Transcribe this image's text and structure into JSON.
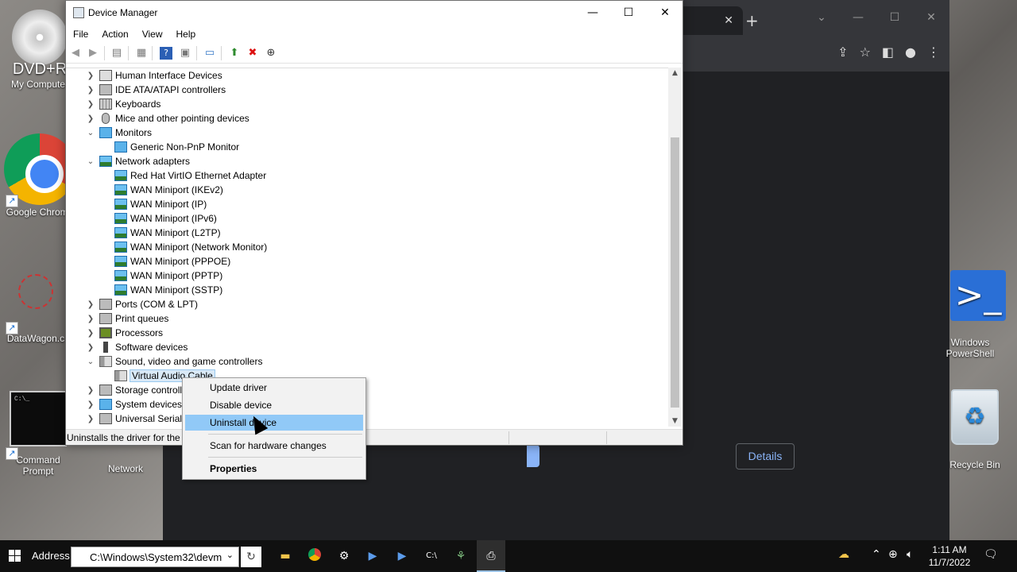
{
  "desktop": {
    "icons": [
      {
        "name": "dvd-drive",
        "label": "DVD+R",
        "sublabel": "My Computer"
      },
      {
        "name": "google-chrome",
        "label": "Google Chrome"
      },
      {
        "name": "datawagon",
        "label": "DataWagon.c"
      },
      {
        "name": "command-prompt",
        "label": "Command Prompt"
      },
      {
        "name": "network",
        "label": "Network"
      },
      {
        "name": "windows-powershell",
        "label": "Windows PowerShell"
      },
      {
        "name": "recycle-bin",
        "label": "Recycle Bin"
      }
    ]
  },
  "browser": {
    "tab_close": "✕",
    "new_tab": "+",
    "details_button": "Details"
  },
  "window": {
    "title": "Device Manager",
    "controls": {
      "minimize": "—",
      "maximize": "☐",
      "close": "✕"
    },
    "menu": [
      "File",
      "Action",
      "View",
      "Help"
    ],
    "tree": [
      {
        "label": "Human Interface Devices",
        "level": 0,
        "state": "collapsed",
        "icon": "hid-icon"
      },
      {
        "label": "IDE ATA/ATAPI controllers",
        "level": 0,
        "state": "collapsed",
        "icon": "ide-controller-icon"
      },
      {
        "label": "Keyboards",
        "level": 0,
        "state": "collapsed",
        "icon": "keyboard-icon"
      },
      {
        "label": "Mice and other pointing devices",
        "level": 0,
        "state": "collapsed",
        "icon": "mouse-icon"
      },
      {
        "label": "Monitors",
        "level": 0,
        "state": "expanded",
        "icon": "monitor-icon"
      },
      {
        "label": "Generic Non-PnP Monitor",
        "level": 1,
        "state": "leaf",
        "icon": "monitor-icon"
      },
      {
        "label": "Network adapters",
        "level": 0,
        "state": "expanded",
        "icon": "network-adapter-icon"
      },
      {
        "label": "Red Hat VirtIO Ethernet Adapter",
        "level": 1,
        "state": "leaf",
        "icon": "network-adapter-icon"
      },
      {
        "label": "WAN Miniport (IKEv2)",
        "level": 1,
        "state": "leaf",
        "icon": "network-adapter-icon"
      },
      {
        "label": "WAN Miniport (IP)",
        "level": 1,
        "state": "leaf",
        "icon": "network-adapter-icon"
      },
      {
        "label": "WAN Miniport (IPv6)",
        "level": 1,
        "state": "leaf",
        "icon": "network-adapter-icon"
      },
      {
        "label": "WAN Miniport (L2TP)",
        "level": 1,
        "state": "leaf",
        "icon": "network-adapter-icon"
      },
      {
        "label": "WAN Miniport (Network Monitor)",
        "level": 1,
        "state": "leaf",
        "icon": "network-adapter-icon"
      },
      {
        "label": "WAN Miniport (PPPOE)",
        "level": 1,
        "state": "leaf",
        "icon": "network-adapter-icon"
      },
      {
        "label": "WAN Miniport (PPTP)",
        "level": 1,
        "state": "leaf",
        "icon": "network-adapter-icon"
      },
      {
        "label": "WAN Miniport (SSTP)",
        "level": 1,
        "state": "leaf",
        "icon": "network-adapter-icon"
      },
      {
        "label": "Ports (COM & LPT)",
        "level": 0,
        "state": "collapsed",
        "icon": "port-icon"
      },
      {
        "label": "Print queues",
        "level": 0,
        "state": "collapsed",
        "icon": "printer-icon"
      },
      {
        "label": "Processors",
        "level": 0,
        "state": "collapsed",
        "icon": "processor-icon"
      },
      {
        "label": "Software devices",
        "level": 0,
        "state": "collapsed",
        "icon": "software-device-icon"
      },
      {
        "label": "Sound, video and game controllers",
        "level": 0,
        "state": "expanded",
        "icon": "speaker-icon"
      },
      {
        "label": "Virtual Audio Cable",
        "level": 1,
        "state": "leaf",
        "icon": "speaker-icon",
        "selected": true
      },
      {
        "label": "Storage controll",
        "level": 0,
        "state": "collapsed",
        "icon": "storage-controller-icon"
      },
      {
        "label": "System devices",
        "level": 0,
        "state": "collapsed",
        "icon": "system-device-icon"
      },
      {
        "label": "Universal Serial",
        "level": 0,
        "state": "collapsed",
        "icon": "usb-icon"
      }
    ],
    "status_text": "Uninstalls the driver for the"
  },
  "context_menu": {
    "items": [
      {
        "label": "Update driver",
        "highlighted": false,
        "bold": false
      },
      {
        "label": "Disable device",
        "highlighted": false,
        "bold": false
      },
      {
        "label": "Uninstall device",
        "highlighted": true,
        "bold": false
      },
      {
        "label": "Scan for hardware changes",
        "highlighted": false,
        "bold": false
      },
      {
        "label": "Properties",
        "highlighted": false,
        "bold": true
      }
    ]
  },
  "taskbar": {
    "address_label": "Address",
    "address_value": "C:\\Windows\\System32\\devm",
    "refresh": "↻",
    "clock_time": "1:11 AM",
    "clock_date": "11/7/2022"
  },
  "colors": {
    "highlight": "#91c9f7",
    "selection": "#d9e9f7",
    "taskbar": "#101010",
    "browser_bg": "#202124"
  }
}
